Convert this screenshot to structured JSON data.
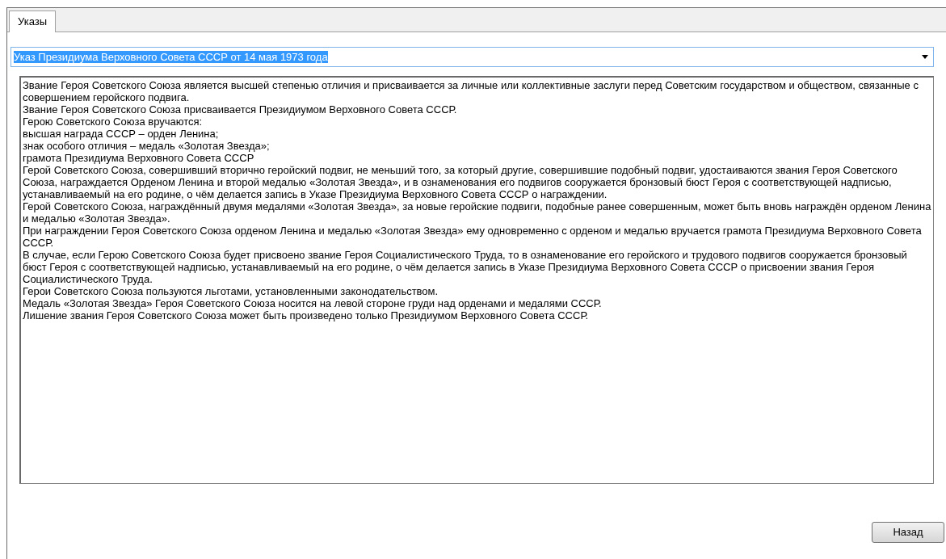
{
  "tabs": [
    {
      "label": "Указы",
      "selected": true
    }
  ],
  "decree_select": {
    "value": "Указ Президиума Верховного Совета СССР от 14 мая 1973 года",
    "text_highlighted": true
  },
  "document_text": [
    "Звание Героя Советского Союза является высшей степенью отличия и присваивается за личные или коллективные заслуги перед Советским государством и обществом, связанные с совершением геройского подвига.",
    "Звание Героя Советского Союза присваивается Президиумом Верховного Совета СССР.",
    "Герою Советского Союза вручаются:",
    "высшая награда СССР – орден Ленина;",
    "знак особого отличия – медаль «Золотая Звезда»;",
    "грамота Президиума Верховного Совета СССР",
    "Герой Советского Союза, совершивший вторично геройский подвиг, не меньший того, за который другие, совершившие подобный подвиг, удостаиваются звания Героя Советского Союза, награждается Орденом Ленина и второй медалью «Золотая Звезда», и в ознаменования его подвигов сооружается бронзовый бюст Героя с соответствующей надписью, устанавливаемый на его родине, о чём делается запись в Указе Президиума Верховного Совета СССР о награждении.",
    "Герой Советского Союза, награждённый двумя медалями «Золотая Звезда», за новые геройские подвиги, подобные ранее совершенным, может быть вновь награждён орденом Ленина и медалью «Золотая Звезда».",
    "При награждении Героя Советского Союза орденом Ленина и медалью «Золотая Звезда» ему одновременно с орденом и медалью вручается грамота Президиума Верховного Совета СССР.",
    "В случае, если Герою Советского Союза будет присвоено звание Героя Социалистического Труда, то в ознаменование его геройского и трудового подвигов сооружается бронзовый бюст Героя с соответствующей надписью, устанавливаемый на его родине, о чём делается запись в Указе Президиума Верховного Совета СССР о присвоении звания Героя Социалистического Труда.",
    "Герои Советского Союза пользуются льготами, установленными законодательством.",
    "Медаль «Золотая Звезда» Героя Советского Союза носится на левой стороне груди над орденами и медалями СССР.",
    "Лишение звания Героя Советского Союза может быть произведено только Президиумом Верховного Совета СССР."
  ],
  "buttons": [
    {
      "label": "Назад"
    }
  ]
}
